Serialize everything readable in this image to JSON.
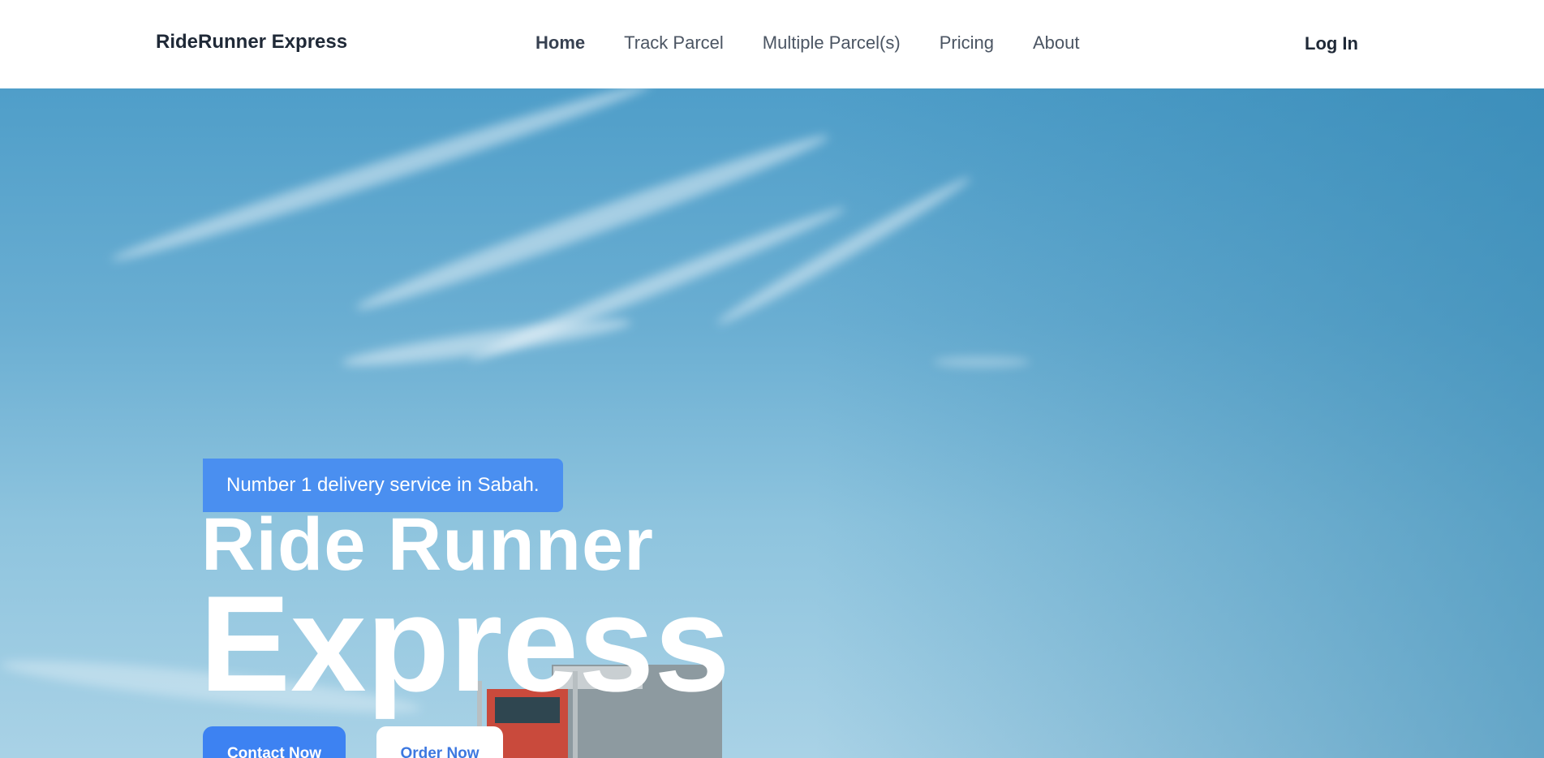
{
  "nav": {
    "brand": "RideRunner Express",
    "links": [
      {
        "label": "Home",
        "active": true
      },
      {
        "label": "Track Parcel",
        "active": false
      },
      {
        "label": "Multiple Parcel(s)",
        "active": false
      },
      {
        "label": "Pricing",
        "active": false
      },
      {
        "label": "About",
        "active": false
      }
    ],
    "login": "Log In"
  },
  "hero": {
    "badge": "Number 1 delivery service in Sabah.",
    "title_line1": "Ride Runner",
    "title_line2": "Express",
    "contact_button": "Contact Now",
    "order_button": "Order Now",
    "background": "sky-with-truck"
  },
  "colors": {
    "accent": "#3d82f2",
    "badge": "#4a8ff0",
    "nav_text": "#4b5563",
    "brand_text": "#1f2937"
  }
}
